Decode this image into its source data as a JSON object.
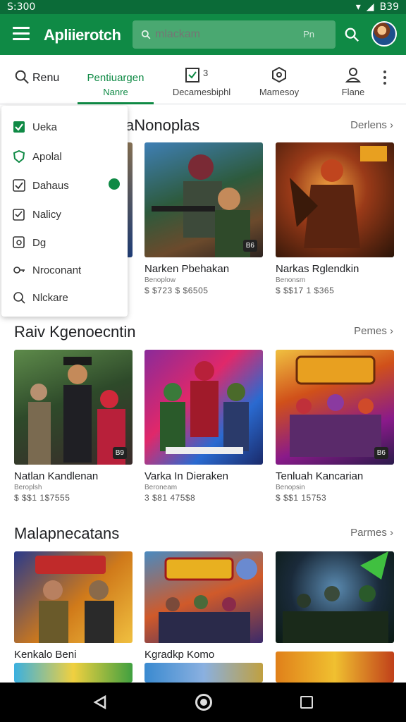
{
  "status_bar": {
    "time": "S:300",
    "battery": "B39"
  },
  "app_bar": {
    "title": "Apliierotch",
    "search_placeholder": "mlackam",
    "search_hint": "Pn"
  },
  "tabs": [
    {
      "label": "Renu",
      "sub": ""
    },
    {
      "label": "Pentiuargen",
      "sub": "Nanre"
    },
    {
      "label": "Decamesbiphl",
      "sub": "3"
    },
    {
      "label": "Mamesoy",
      "sub": ""
    },
    {
      "label": "Flane",
      "sub": ""
    }
  ],
  "dropdown": {
    "items": [
      "Ueka",
      "Apolal",
      "Dahaus",
      "Nalicy",
      "Dg",
      "Nroconant",
      "Nlckare"
    ]
  },
  "sections": [
    {
      "title": "aNonoplas",
      "more": "Derlens",
      "cards": [
        {
          "name": "",
          "sub": "",
          "price": "",
          "badge": ""
        },
        {
          "name": "Narken Pbehakan",
          "sub": "Benoplow",
          "price": "$ $723 $ $6505",
          "badge": "B6"
        },
        {
          "name": "Narkas Rglendkin",
          "sub": "Benonsm",
          "price": "$ $$17 1 $365",
          "badge": ""
        }
      ]
    },
    {
      "title": "Raiv Kgenoecntin",
      "more": "Pemes",
      "cards": [
        {
          "name": "Natlan Kandlenan",
          "sub": "Beroplsh",
          "price": "$ $$1 1$7555",
          "badge": "B9"
        },
        {
          "name": "Varka In Dieraken",
          "sub": "Beroneam",
          "price": "3 $81 475$8",
          "badge": ""
        },
        {
          "name": "Tenluah Kancarian",
          "sub": "Benopsin",
          "price": "$ $$1 15753",
          "badge": "B6"
        }
      ]
    },
    {
      "title": "Malapnecatans",
      "more": "Parmes",
      "cards": [
        {
          "name": "Kenkalo Beni",
          "sub": "",
          "price": "",
          "badge": ""
        },
        {
          "name": "Kgradkp Komo",
          "sub": "",
          "price": "",
          "badge": ""
        },
        {
          "name": "",
          "sub": "",
          "price": "",
          "badge": ""
        }
      ]
    }
  ],
  "colors": {
    "brand_green": "#0f8a45",
    "status_green": "#0b6b38"
  }
}
